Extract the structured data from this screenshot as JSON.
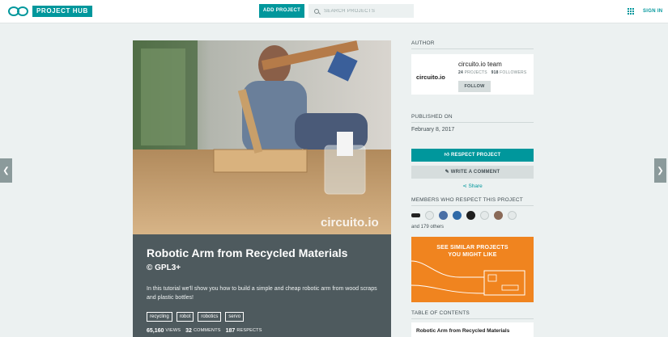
{
  "header": {
    "logo_text": "PROJECT HUB",
    "add_project_label": "ADD PROJECT",
    "search_placeholder": "SEARCH PROJECTS",
    "sign_in_label": "SIGN IN"
  },
  "nav": {
    "prev_icon": "chevron-left-icon",
    "next_icon": "chevron-right-icon"
  },
  "project": {
    "hero_watermark": "circuito.io",
    "title": "Robotic Arm from Recycled Materials",
    "license": "© GPL3+",
    "description": "In this tutorial we'll show you how to build a simple and cheap robotic arm from wood scraps and plastic bottles!",
    "tags": [
      "recycling",
      "robot",
      "robotics",
      "servo"
    ],
    "stats": {
      "views_count": "65,160",
      "views_label": "VIEWS",
      "comments_count": "32",
      "comments_label": "COMMENTS",
      "respects_count": "187",
      "respects_label": "RESPECTS"
    }
  },
  "sidebar": {
    "author_title": "AUTHOR",
    "author_logo": "circuito.io",
    "author_name": "circuito.io team",
    "author_projects_count": "24",
    "author_projects_label": "PROJECTS",
    "author_followers_count": "918",
    "author_followers_label": "FOLLOWERS",
    "follow_label": "FOLLOW",
    "published_title": "PUBLISHED ON",
    "published_date": "February 8, 2017",
    "respect_label": "RESPECT PROJECT",
    "comment_label": "WRITE A COMMENT",
    "share_label": "Share",
    "members_title": "MEMBERS WHO RESPECT THIS PROJECT",
    "members_others": "and 179 others",
    "similar_line1": "SEE SIMILAR PROJECTS",
    "similar_line2": "YOU MIGHT LIKE",
    "toc_title": "TABLE OF CONTENTS",
    "toc_items": [
      "Robotic Arm from Recycled Materials"
    ]
  },
  "colors": {
    "accent": "#00979c",
    "panel": "#4e5a5e",
    "similar_bg": "#f0841f",
    "background": "#ecf1f1"
  }
}
